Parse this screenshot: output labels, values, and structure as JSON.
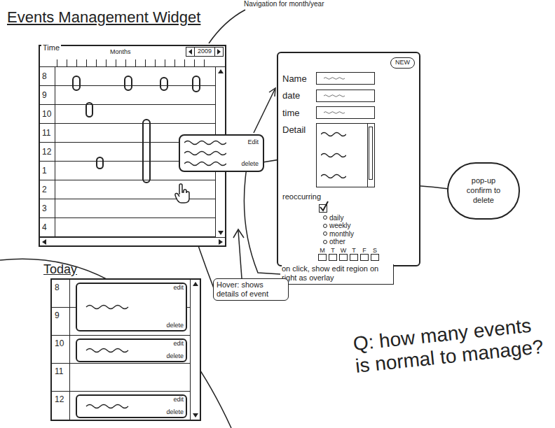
{
  "title": "Events Management Widget",
  "annotations": {
    "nav": "Navigation for month/year",
    "popup": "pop-up confirm to delete",
    "onclick": "on click, show edit region on right as overlay",
    "hover": "Hover: shows details of event",
    "question": "Q: how many events is normal to manage?"
  },
  "calendar": {
    "time_label": "Time",
    "months_label": "Months",
    "year": "2009",
    "hours": [
      "8",
      "9",
      "10",
      "11",
      "12",
      "1",
      "2",
      "3",
      "4"
    ]
  },
  "popover": {
    "edit": "Edit",
    "delete": "delete"
  },
  "form": {
    "new_button": "NEW",
    "fields": [
      {
        "label": "Name"
      },
      {
        "label": "date"
      },
      {
        "label": "time"
      }
    ],
    "detail_label": "Detail",
    "recurring": {
      "label": "reoccurring",
      "checked": true,
      "options": [
        {
          "label": "daily",
          "selected": false
        },
        {
          "label": "weekly",
          "selected": false
        },
        {
          "label": "monthly",
          "selected": false
        },
        {
          "label": "other",
          "selected": false
        }
      ],
      "days": [
        "M",
        "T",
        "W",
        "T",
        "F",
        "S"
      ]
    }
  },
  "today": {
    "title": "Today",
    "hours": [
      "8",
      "9",
      "10",
      "11",
      "12"
    ],
    "events": [
      {
        "edit": "edit",
        "delete": "delete"
      },
      {
        "edit": "edit",
        "delete": "delete"
      },
      {
        "edit": "edit",
        "delete": "delete"
      }
    ]
  }
}
